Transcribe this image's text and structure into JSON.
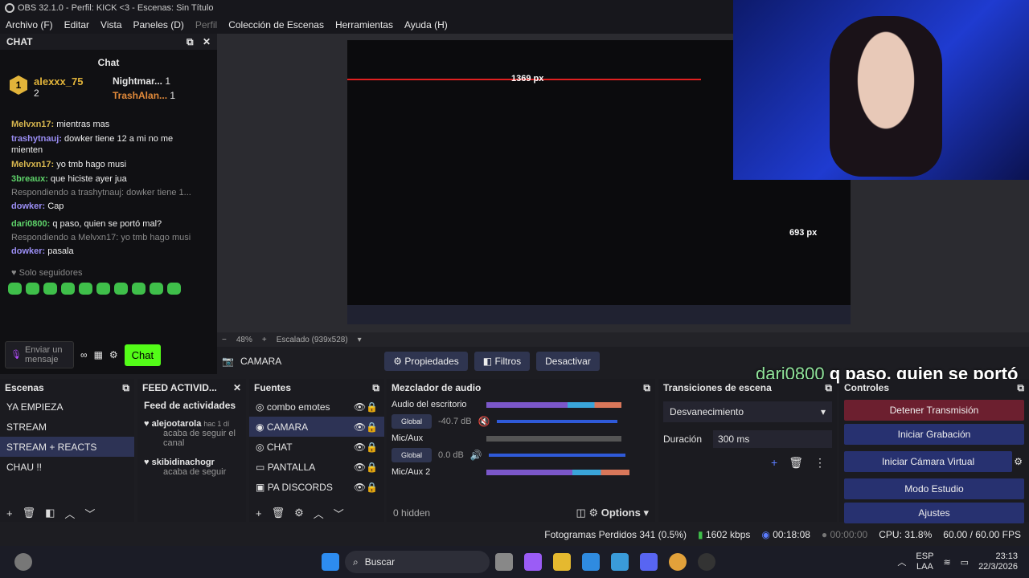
{
  "title": "OBS 32.1.0 - Perfil: KICK <3 - Escenas: Sin Título",
  "menu": [
    "Archivo (F)",
    "Editar",
    "Vista",
    "Paneles (D)",
    "Perfil",
    "Colección de Escenas",
    "Herramientas",
    "Ayuda (H)"
  ],
  "chat": {
    "dock_title": "CHAT",
    "title": "Chat",
    "leaderboard": [
      {
        "name": "alexxx_75",
        "count": "2"
      },
      {
        "name": "Nightmar...",
        "count": "1"
      },
      {
        "name": "TrashAlan...",
        "count": "1"
      }
    ],
    "messages": [
      {
        "user": "Melvxn17:",
        "text": "mientras mas"
      },
      {
        "user": "trashytnauj:",
        "text": "dowker tiene 12 a mi no me mienten"
      },
      {
        "user": "Melvxn17:",
        "text": "yo tmb hago musi"
      },
      {
        "user": "3breaux:",
        "text": "que hiciste ayer jua"
      },
      {
        "reply": "Respondiendo a trashytnauj: dowker tiene 1...",
        "user": "dowker:",
        "text": "Cap"
      },
      {
        "user": "dari0800:",
        "text": "q paso, quien se portó mal?"
      },
      {
        "reply": "Respondiendo a Melvxn17: yo tmb hago musi",
        "user": "dowker:",
        "text": "pasala"
      }
    ],
    "followers_only": "Solo seguidores",
    "input_placeholder": "Enviar un mensaje",
    "send": "Chat"
  },
  "preview": {
    "zoom": "48%",
    "scale": "Escalado (939x528)",
    "overlay_user": "dari0800",
    "overlay_text": "q paso, quien se portó mal?"
  },
  "source_bar": {
    "source": "CAMARA",
    "props": "Propiedades",
    "filters": "Filtros",
    "deactivate": "Desactivar"
  },
  "scenes": {
    "title": "Escenas",
    "items": [
      "YA EMPIEZA",
      "STREAM",
      "STREAM + REACTS",
      "CHAU !!"
    ],
    "selected": 2
  },
  "feed": {
    "title": "FEED ACTIVID...",
    "header": "Feed de actividades",
    "items": [
      {
        "user": "alejootarola",
        "time": "hac 1 dí",
        "text": "acaba de seguir el canal"
      },
      {
        "user": "skibidinachogr",
        "text": "acaba de seguir"
      }
    ]
  },
  "sources": {
    "title": "Fuentes",
    "items": [
      "combo emotes",
      "CAMARA",
      "CHAT",
      "PANTALLA",
      "PA DISCORDS"
    ],
    "hidden": "0 hidden",
    "options": "Options"
  },
  "mixer": {
    "title": "Mezclador de audio",
    "channels": [
      {
        "name": "Audio del escritorio",
        "db": "-40.7 dB",
        "label": "Global"
      },
      {
        "name": "Mic/Aux",
        "db": "0.0 dB",
        "label": "Global"
      },
      {
        "name": "Mic/Aux 2",
        "db": "",
        "label": ""
      }
    ],
    "scale": [
      "-60",
      "-54",
      "-48",
      "-42",
      "-36",
      "-30",
      "-24",
      "-18",
      "-12",
      "-6",
      "0"
    ]
  },
  "transitions": {
    "title": "Transiciones de escena",
    "type": "Desvanecimiento",
    "duration_label": "Duración",
    "duration": "300 ms"
  },
  "controls": {
    "title": "Controles",
    "buttons": [
      "Detener Transmisión",
      "Iniciar Grabación",
      "Iniciar Cámara Virtual",
      "Modo Estudio",
      "Ajustes"
    ]
  },
  "status": {
    "dropped": "Fotogramas Perdidos 341 (0.5%)",
    "kbps": "1602 kbps",
    "stream_time": "00:18:08",
    "rec_time": "00:00:00",
    "cpu": "CPU: 31.8%",
    "fps": "60.00 / 60.00 FPS"
  },
  "taskbar": {
    "search": "Buscar",
    "lang": "ESP",
    "lang2": "LAA",
    "time": "23:13",
    "date": "22/3/2026"
  },
  "measure": {
    "w": "1369 px",
    "h": "693 px"
  }
}
